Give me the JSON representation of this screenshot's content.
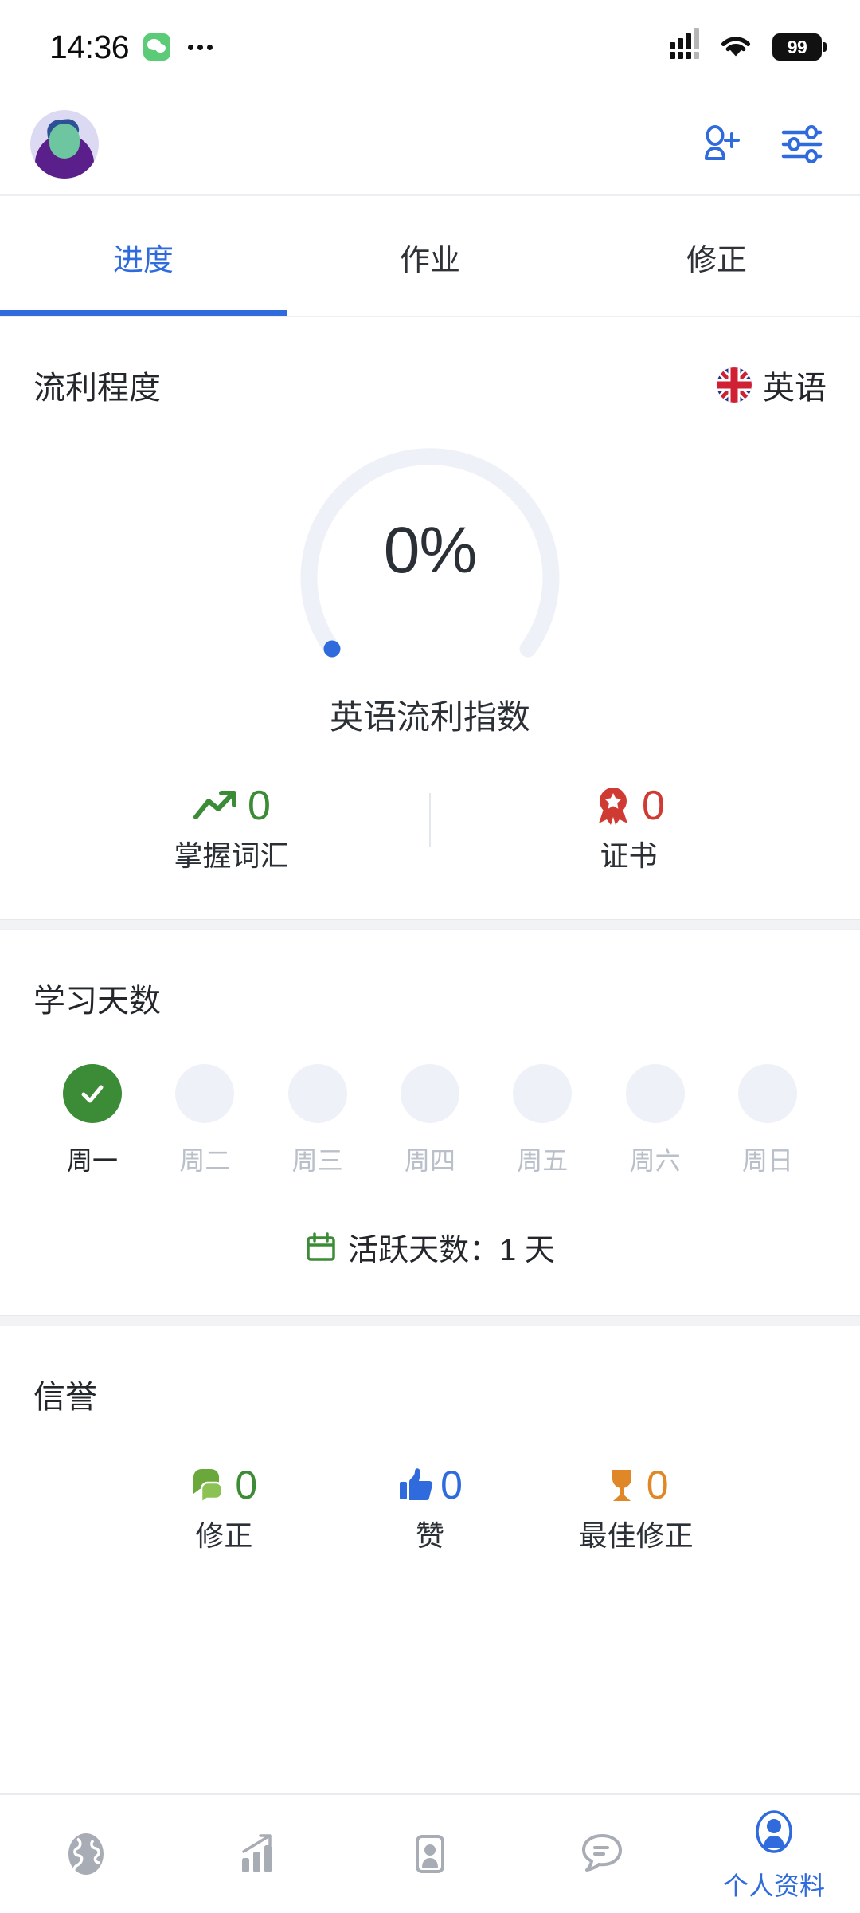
{
  "status_bar": {
    "time": "14:36",
    "app_badge_icon": "wechat-icon",
    "overflow_icon": "more-dots-icon",
    "signal_icon": "cellular-signal-icon",
    "wifi_icon": "wifi-icon",
    "battery_level": "99"
  },
  "header": {
    "avatar_icon": "user-avatar",
    "add_friend_label": "add-friend",
    "settings_label": "settings-sliders"
  },
  "tabs": [
    {
      "label": "进度",
      "active": true
    },
    {
      "label": "作业",
      "active": false
    },
    {
      "label": "修正",
      "active": false
    }
  ],
  "fluency": {
    "title": "流利程度",
    "language": "英语",
    "flag_icon": "uk-flag-icon",
    "percent_text": "0%",
    "percent_value": 0,
    "caption": "英语流利指数",
    "stats": [
      {
        "icon": "trending-up-icon",
        "value": "0",
        "label": "掌握词汇",
        "color": "#3c8b36"
      },
      {
        "icon": "award-medal-icon",
        "value": "0",
        "label": "证书",
        "color": "#cf3a33"
      }
    ]
  },
  "study_days": {
    "title": "学习天数",
    "days": [
      {
        "name": "周一",
        "done": true
      },
      {
        "name": "周二",
        "done": false
      },
      {
        "name": "周三",
        "done": false
      },
      {
        "name": "周四",
        "done": false
      },
      {
        "name": "周五",
        "done": false
      },
      {
        "name": "周六",
        "done": false
      },
      {
        "name": "周日",
        "done": false
      }
    ],
    "active_days_icon": "calendar-icon",
    "active_days_text": "活跃天数：1 天"
  },
  "reputation": {
    "title": "信誉",
    "items": [
      {
        "icon": "chat-bubbles-icon",
        "value": "0",
        "label": "修正",
        "color": "#6aa83c"
      },
      {
        "icon": "thumbs-up-icon",
        "value": "0",
        "label": "赞",
        "color": "#2f6bdd"
      },
      {
        "icon": "trophy-icon",
        "value": "0",
        "label": "最佳修正",
        "color": "#e08828"
      }
    ]
  },
  "bottom_nav": [
    {
      "icon": "globe-icon",
      "label": "",
      "active": false
    },
    {
      "icon": "stats-chart-icon",
      "label": "",
      "active": false
    },
    {
      "icon": "id-card-icon",
      "label": "",
      "active": false
    },
    {
      "icon": "chat-icon",
      "label": "",
      "active": false
    },
    {
      "icon": "profile-icon",
      "label": "个人资料",
      "active": true
    }
  ],
  "colors": {
    "accent": "#2f6bdd",
    "green": "#3c8b36",
    "red": "#cf3a33",
    "orange": "#e08828",
    "muted": "#b9c0c9",
    "track": "#eef1f7"
  }
}
